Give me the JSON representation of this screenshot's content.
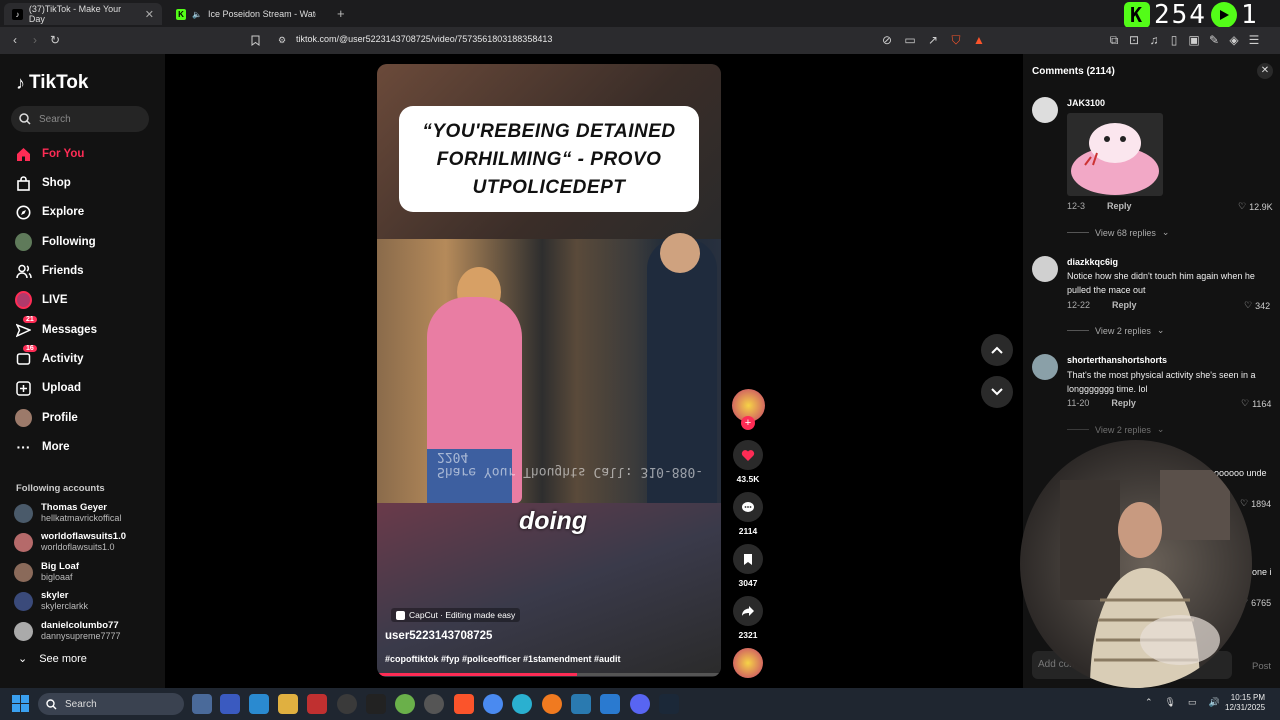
{
  "browser": {
    "tabs": [
      {
        "label": "(37)TikTok - Make Your Day",
        "active": true
      },
      {
        "label": "Ice Poseidon Stream - Watch Live",
        "active": false
      }
    ],
    "url": "tiktok.com/@user5223143708725/video/7573561803188358413"
  },
  "overlay": {
    "counter": "254",
    "extra": "1"
  },
  "sidebar": {
    "logo": "TikTok",
    "search_placeholder": "Search",
    "nav": [
      {
        "label": "For You",
        "icon": "home-icon",
        "active": true
      },
      {
        "label": "Shop",
        "icon": "shop-icon"
      },
      {
        "label": "Explore",
        "icon": "compass-icon"
      },
      {
        "label": "Following",
        "icon": "following-avatar-icon"
      },
      {
        "label": "Friends",
        "icon": "friends-icon"
      },
      {
        "label": "LIVE",
        "icon": "live-icon"
      },
      {
        "label": "Messages",
        "icon": "messages-icon",
        "badge": "21"
      },
      {
        "label": "Activity",
        "icon": "activity-icon",
        "badge": "16"
      },
      {
        "label": "Upload",
        "icon": "upload-icon"
      },
      {
        "label": "Profile",
        "icon": "profile-avatar-icon"
      },
      {
        "label": "More",
        "icon": "more-icon"
      }
    ],
    "following_title": "Following accounts",
    "accounts": [
      {
        "name": "Thomas Geyer",
        "handle": "hellkatmavrickoffical"
      },
      {
        "name": "worldoflawsuits1.0",
        "handle": "worldoflawsuits1.0"
      },
      {
        "name": "Big Loaf",
        "handle": "bigloaaf"
      },
      {
        "name": "skyler",
        "handle": "skylerclarkk"
      },
      {
        "name": "danielcolumbo77",
        "handle": "dannysupreme7777"
      }
    ],
    "see_more": "See more"
  },
  "video": {
    "caption": "“YOU'REBEING DETAINED FORHILMING“ - PROVO UTPOLICEDEPT",
    "subtitle": "doing",
    "mirrored_text": "Share Your Thoughts Call: 310-880-2204",
    "capcut": "CapCut · Editing made easy",
    "username": "user5223143708725",
    "hashtags": "#copoftiktok #fyp #policeofficer #1stamendment #audit",
    "progress": 0.58
  },
  "actions": {
    "likes": "43.5K",
    "comments": "2114",
    "saves": "3047",
    "shares": "2321"
  },
  "comments": {
    "title": "Comments (2114)",
    "items": [
      {
        "user": "JAK3100",
        "text": "",
        "date": "12-3",
        "reply": "Reply",
        "likes": "12.9K",
        "view_replies": "View 68 replies"
      },
      {
        "user": "diazkkqc6ig",
        "text": "Notice how she didn't touch him again when he pulled the mace out",
        "date": "12-22",
        "reply": "Reply",
        "likes": "342",
        "view_replies": "View 2 replies"
      },
      {
        "user": "shorterthanshortshorts",
        "text": "That's the most physical activity she's seen in a longgggggg time. lol",
        "date": "11-20",
        "reply": "Reply",
        "likes": "1164",
        "view_replies": "View 2 replies"
      }
    ],
    "partial": [
      {
        "text": "ooooooo unde",
        "likes": "1894"
      },
      {
        "text": "done i",
        "likes": "6765"
      }
    ],
    "add_placeholder": "Add comm",
    "post": "Post"
  },
  "taskbar": {
    "search": "Search",
    "time": "10:15 PM",
    "date": "12/31/2025"
  },
  "colors": {
    "accent": "#fe2c55",
    "bg": "#121212"
  }
}
